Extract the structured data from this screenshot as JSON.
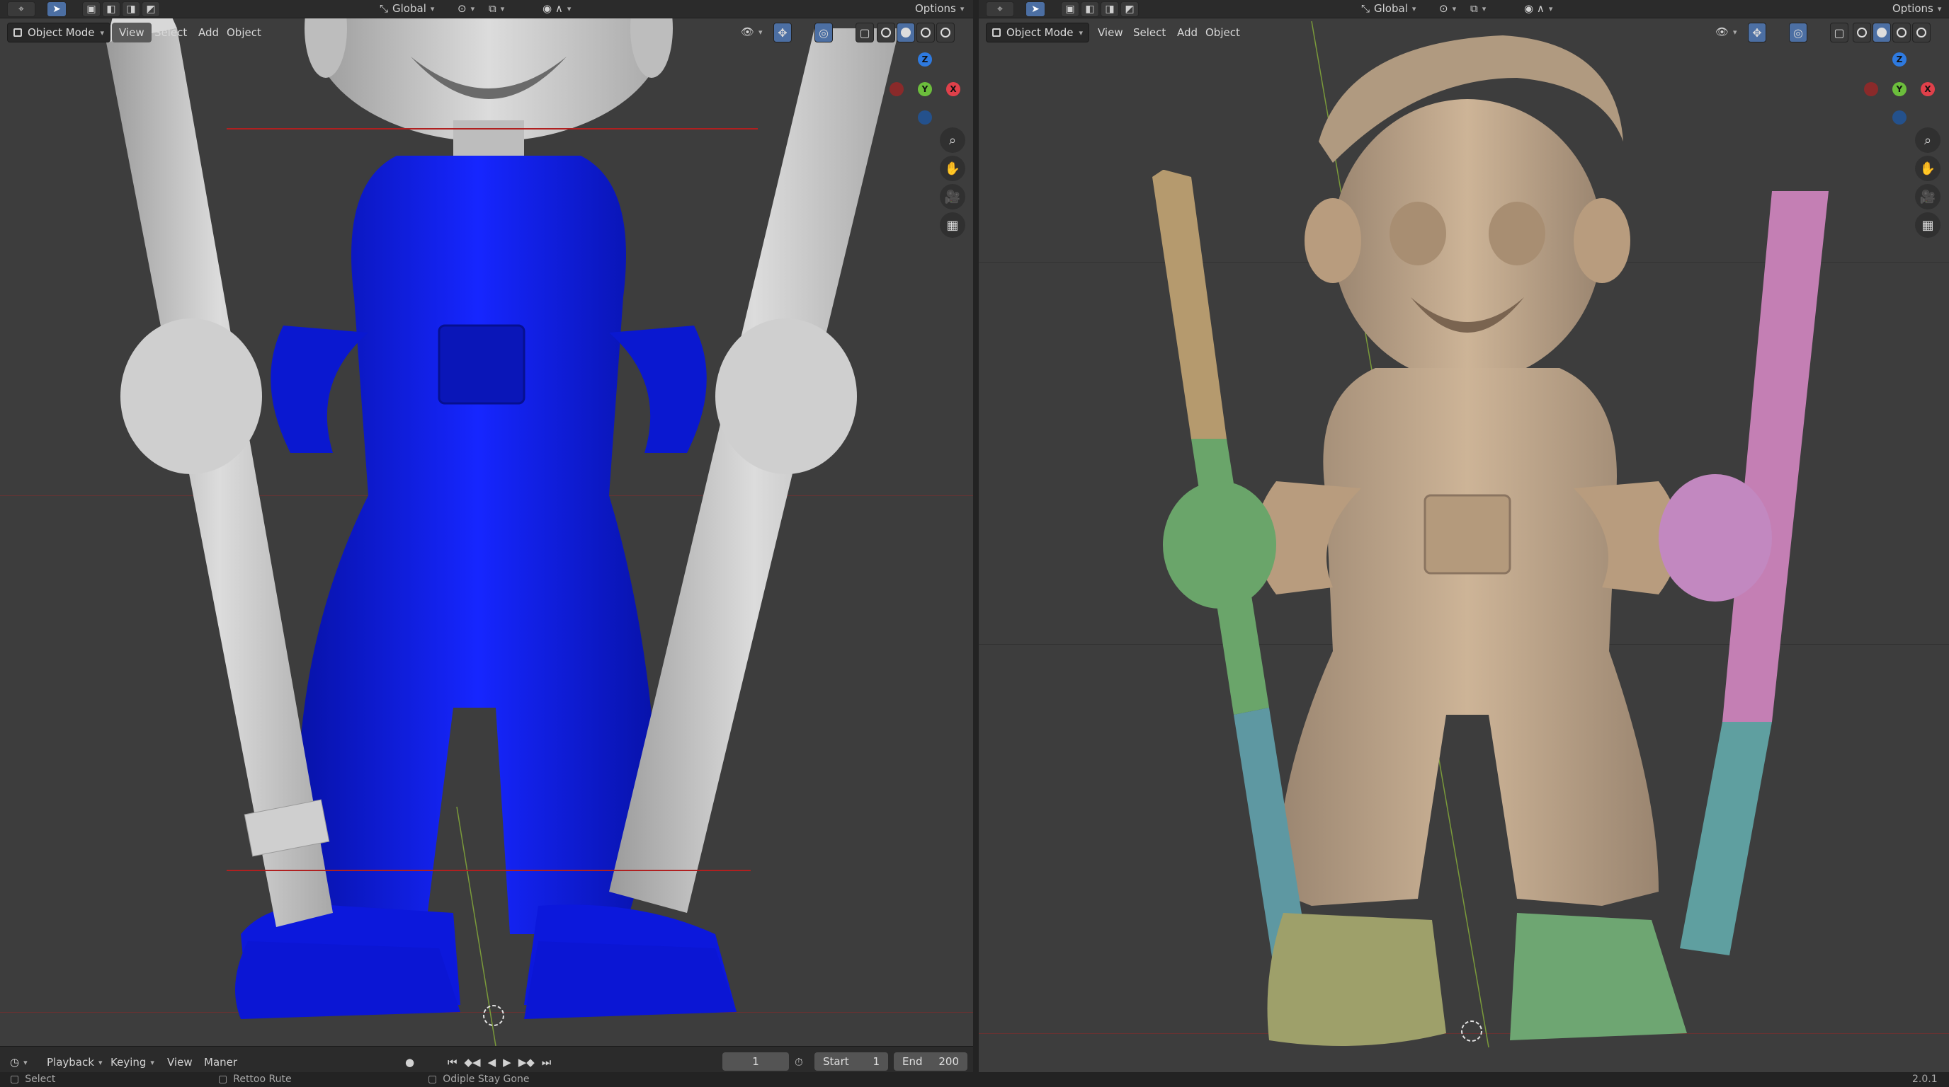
{
  "left_viewport": {
    "top": {
      "orientation": "Global",
      "options": "Options"
    },
    "header": {
      "mode": "Object Mode",
      "menus": [
        "View",
        "Select",
        "Add",
        "Object"
      ],
      "active_menu": "View"
    },
    "gizmo": {
      "z": "Z",
      "y": "Y",
      "x": "X"
    },
    "mesh_colors": {
      "overalls": "#0a14d8",
      "pencil": "#bdbdbd",
      "ruler": "#d0d0d0",
      "skin": "#c8c8c8"
    }
  },
  "right_viewport": {
    "top": {
      "orientation": "Global",
      "options": "Options"
    },
    "header": {
      "mode": "Object Mode",
      "menus": [
        "View",
        "Select",
        "Add",
        "Object"
      ]
    },
    "gizmo": {
      "z": "Z",
      "y": "Y",
      "x": "X"
    },
    "mesh_colors": {
      "body": "#c2a88c",
      "pencil_tip": "#b59a6e",
      "pencil_green": "#6aa56a",
      "pencil_teal": "#5e98a2",
      "ruler_pink": "#c47fb4",
      "ruler_teal": "#5f9fa0",
      "boot_left": "#9ea06a",
      "boot_right": "#6ea672",
      "hand_right": "#c288c0"
    }
  },
  "timeline": {
    "menus": [
      "Playback",
      "Keying",
      "View",
      "Maner"
    ],
    "current_frame": "1",
    "start_label": "Start",
    "start_value": "1",
    "end_label": "End",
    "end_value": "200"
  },
  "statusbar": {
    "left": "Select",
    "middle": "Rettoo Rute",
    "right": "Odiple Stay Gone",
    "version": "2.0.1"
  }
}
